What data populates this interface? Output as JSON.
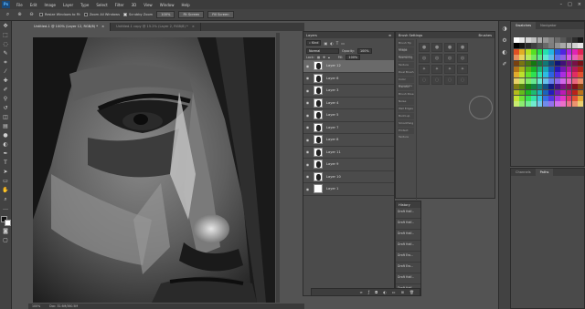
{
  "menubar": {
    "logo": "Ps",
    "items": [
      "File",
      "Edit",
      "Image",
      "Layer",
      "Type",
      "Select",
      "Filter",
      "3D",
      "View",
      "Window",
      "Help"
    ]
  },
  "options": {
    "resize_windows": "Resize Windows to Fit",
    "zoom_all": "Zoom All Windows",
    "scrubby_zoom": "Scrubby Zoom",
    "zoom_value": "100%",
    "fit_screen": "Fit Screen",
    "fill_screen": "Fill Screen"
  },
  "tabs": [
    {
      "label": "Untitled-1 @ 100% (Layer 12, RGB/8) *",
      "active": true
    },
    {
      "label": "Untitled-1 copy @ 15.2% (Layer 2, RGB/8) *",
      "active": false
    }
  ],
  "status": {
    "zoom": "100%",
    "doc": "Doc: 32.6M/380.5M"
  },
  "layers": {
    "title": "Layers",
    "kind": "Kind",
    "blend_mode": "Normal",
    "opacity_label": "Opacity:",
    "opacity": "100%",
    "lock_label": "Lock:",
    "fill_label": "Fill:",
    "fill": "100%",
    "items": [
      {
        "name": "Layer 12",
        "active": true
      },
      {
        "name": "Layer 6",
        "active": false
      },
      {
        "name": "Layer 3",
        "active": false
      },
      {
        "name": "Layer 4",
        "active": false
      },
      {
        "name": "Layer 5",
        "active": false
      },
      {
        "name": "Layer 7",
        "active": false
      },
      {
        "name": "Layer 8",
        "active": false
      },
      {
        "name": "Layer 11",
        "active": false
      },
      {
        "name": "Layer 9",
        "active": false
      },
      {
        "name": "Layer 10",
        "active": false
      },
      {
        "name": "Layer 1",
        "active": false
      }
    ]
  },
  "brush": {
    "title_left": "Brush Settings",
    "title_right": "Brushes",
    "sidebar": [
      "Brush Tip Shape",
      "Shape Dynamics",
      "Scattering",
      "Texture",
      "Dual Brush",
      "Color Dynamics",
      "Transfer",
      "Brush Pose",
      "Noise",
      "Wet Edges",
      "Build-up",
      "Smoothing",
      "Protect Texture"
    ]
  },
  "history": {
    "title": "History",
    "items": [
      "Draft Half...",
      "Draft Half...",
      "Draft Half...",
      "Draft Half...",
      "Draft Ero...",
      "Draft Ero...",
      "Draft Half...",
      "Draft Half...",
      "Draft Ero..."
    ]
  },
  "swatches": {
    "tab1": "Swatches",
    "tab2": "Navigator"
  },
  "paths": {
    "tab1": "Channels",
    "tab2": "Paths"
  }
}
